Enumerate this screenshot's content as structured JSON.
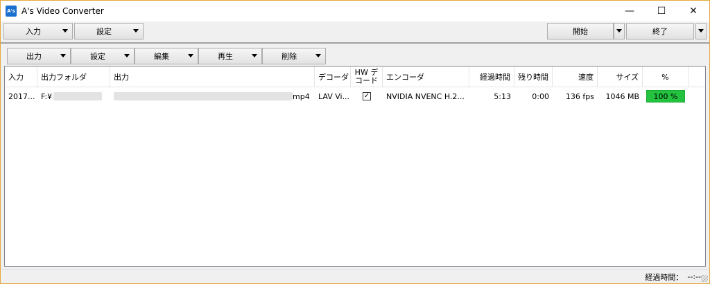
{
  "window": {
    "title": "A's Video Converter",
    "icon_text": "A's",
    "controls": {
      "minimize": "—",
      "maximize": "☐",
      "close": "✕"
    }
  },
  "toolbar": {
    "input_label": "入力",
    "settings_label": "設定",
    "start_label": "開始",
    "exit_label": "終了"
  },
  "subtoolbar": {
    "output_label": "出力",
    "settings_label": "設定",
    "edit_label": "編集",
    "play_label": "再生",
    "delete_label": "削除"
  },
  "table": {
    "columns": [
      "入力",
      "出力フォルダ",
      "出力",
      "デコーダ",
      "HW デコード",
      "エンコーダ",
      "経過時間",
      "残り時間",
      "速度",
      "サイズ",
      "%"
    ],
    "rows": [
      {
        "input": "2017...",
        "output_folder": "F:¥",
        "output_ext": "mp4",
        "decoder": "LAV Vi...",
        "hw_decode": "☑",
        "encoder": "NVIDIA NVENC H.2...",
        "elapsed": "5:13",
        "remaining": "0:00",
        "speed": "136 fps",
        "size": "1046 MB",
        "percent": "100 %",
        "progress": 1.0
      }
    ]
  },
  "status": {
    "elapsed_label": "経過時間：",
    "elapsed_value": "--:--"
  },
  "colors": {
    "accent_border": "#e4a73d",
    "progress_fill": "#23c23f"
  }
}
